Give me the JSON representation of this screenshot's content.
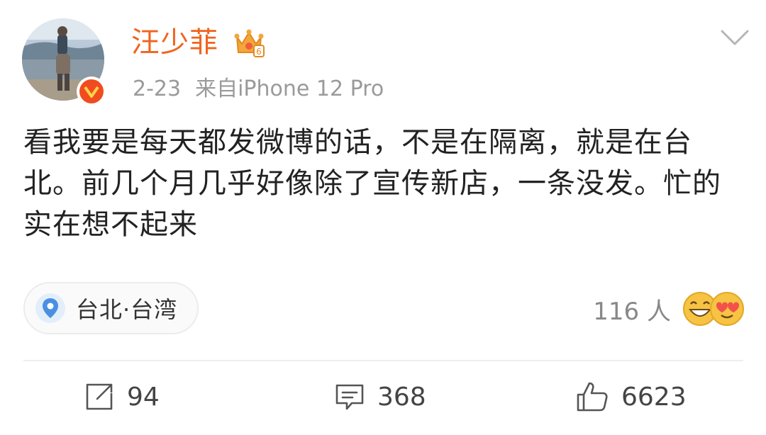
{
  "user": {
    "name": "汪少菲",
    "date": "2-23",
    "source": "来自iPhone 12 Pro"
  },
  "post": {
    "text": "看我要是每天都发微博的话，不是在隔离，就是在台北。前几个月几乎好像除了宣传新店，一条没发。忙的实在想不起来"
  },
  "location": {
    "label": "台北·台湾"
  },
  "reactions": {
    "count_label": "116 人"
  },
  "actions": {
    "reposts": "94",
    "comments": "368",
    "likes": "6623"
  },
  "colors": {
    "username": "#f0641e",
    "verified_badge": "#f04c1f",
    "location_pin": "#4a90e2",
    "meta_text": "#9a9a9a"
  },
  "icons": {
    "crown": "crown-level-icon",
    "verified": "verified-v-icon",
    "more": "chevron-down-icon",
    "location": "location-pin-icon",
    "repost": "repost-icon",
    "comment": "comment-icon",
    "like": "thumbs-up-icon"
  }
}
